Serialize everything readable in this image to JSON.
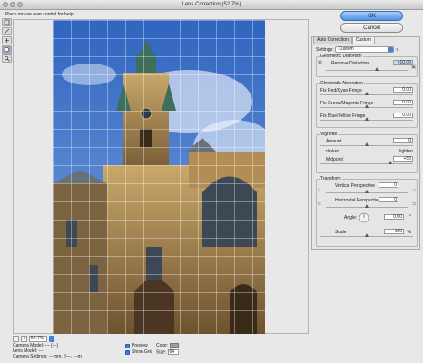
{
  "window": {
    "title": "Lens Correction (52.7%)"
  },
  "help": {
    "text": "Place mouse over control for help"
  },
  "buttons": {
    "ok": "OK",
    "cancel": "Cancel"
  },
  "tabs": [
    {
      "label": "Auto Correction"
    },
    {
      "label": "Custom"
    }
  ],
  "settings": {
    "label": "Settings:",
    "value": "Custom"
  },
  "geometric": {
    "legend": "Geometric Distortion",
    "remove_label": "Remove Distortion",
    "remove_value": "+10.00",
    "level": 0.62
  },
  "chromatic": {
    "legend": "Chromatic Aberration",
    "items": [
      {
        "label": "Fix Red/Cyan Fringe",
        "value": "0.00",
        "level": 0.5
      },
      {
        "label": "Fix Green/Magenta Fringe",
        "value": "0.00",
        "level": 0.5
      },
      {
        "label": "Fix Blue/Yellow Fringe",
        "value": "0.00",
        "level": 0.5
      }
    ]
  },
  "vignette": {
    "legend": "Vignette",
    "amount_label": "Amount",
    "amount_value": "0",
    "amount_level": 0.5,
    "darken": "darken",
    "lighten": "lighten",
    "midpoint_label": "Midpoint",
    "midpoint_value": "+50",
    "midpoint_level": 0.75
  },
  "transform": {
    "legend": "Transform",
    "vertical_label": "Vertical Perspective",
    "vertical_value": "0",
    "vertical_level": 0.5,
    "horizontal_label": "Horizontal Perspective",
    "horizontal_value": "0",
    "horizontal_level": 0.5,
    "angle_label": "Angle:",
    "angle_value": "0.00",
    "angle_unit": "°",
    "scale_label": "Scale",
    "scale_value": "100",
    "scale_unit": "%",
    "scale_level": 0.5
  },
  "zoom": {
    "value": "52.7%",
    "minus": "−",
    "plus": "+"
  },
  "camera": {
    "model": "Camera Model: --- (---)",
    "lens": "Lens Model: ---",
    "settings": "Camera Settings: ---mm, f/---, ---m"
  },
  "options": {
    "preview": "Preview",
    "show_grid": "Show Grid",
    "color_label": "Color:",
    "size_label": "Size:",
    "size_value": "64"
  },
  "colors": {
    "accent": "#4a7ed8",
    "sky": "#3c6fc4",
    "stone": "#a07a44"
  }
}
